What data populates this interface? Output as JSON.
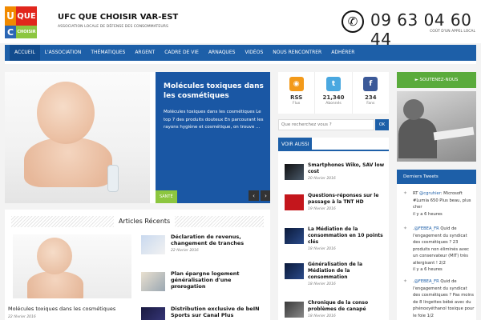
{
  "header": {
    "logo": {
      "u": "U",
      "que": "QUE",
      "c": "C",
      "choisir": "CHOISIR"
    },
    "title": "UFC QUE CHOISIR VAR-EST",
    "subtitle": "ASSOCIATION LOCALE DE DÉFENSE DES CONSOMMATEURS",
    "phone_icon": "phone-icon",
    "phone_number": "09 63 04 60 44",
    "phone_sub": "COÛT D'UN APPEL LOCAL"
  },
  "nav": [
    "ACCUEIL",
    "L'ASSOCIATION",
    "THÉMATIQUES",
    "ARGENT",
    "CADRE DE VIE",
    "ARNAQUES",
    "VIDÉOS",
    "NOUS RENCONTRER",
    "ADHÉRER"
  ],
  "slider": {
    "title": "Molécules toxiques dans les cosmétiques",
    "text": "Molécules toxiques dans les cosmétiques Le top 7 des produits douteux En parcourant les rayons hygiène et cosmétique, on trouve ...",
    "tag": "SANTÉ",
    "prev": "‹",
    "next": "›"
  },
  "articles": {
    "heading": "Articles Récents",
    "featured": {
      "title": "Molécules toxiques dans les cosmétiques",
      "date": "22 février 2016"
    },
    "items": [
      {
        "title": "Déclaration de revenus, changement de tranches",
        "date": "22 février 2016"
      },
      {
        "title": "Plan épargne logement généralisation d'une prorogation",
        "date": "21 février 2016"
      },
      {
        "title": "Distribution exclusive de beIN Sports sur Canal Plus",
        "date": ""
      }
    ]
  },
  "social": [
    {
      "icon": "rss-icon",
      "glyph": "◉",
      "count": "RSS",
      "label": "Flux"
    },
    {
      "icon": "twitter-icon",
      "glyph": "t",
      "count": "21,340",
      "label": "Abonnés"
    },
    {
      "icon": "facebook-icon",
      "glyph": "f",
      "count": "234",
      "label": "Fans"
    }
  ],
  "search": {
    "placeholder": "Que recherchez vous ?",
    "button": "OK"
  },
  "voir_aussi": {
    "heading": "VOIR AUSSI",
    "items": [
      {
        "title": "Smartphones Wiko, SAV low cost",
        "date": "20 février 2016"
      },
      {
        "title": "Questions-réponses sur le passage à la TNT HD",
        "date": "19 février 2016"
      },
      {
        "title": "La Médiation de la consommation en 10 points clés",
        "date": "18 février 2016"
      },
      {
        "title": "Généralisation de la Médiation de la consommation",
        "date": "18 février 2016"
      },
      {
        "title": "Chronique de la conso problèmes de canapé",
        "date": "18 février 2016"
      }
    ]
  },
  "sidebar": {
    "soutenez": "►  SOUTENEZ-NOUS",
    "tweets_heading": "Derniers Tweets",
    "tweets": [
      {
        "pre": "RT ",
        "handle": "@cgruhier",
        "text": ": Microsoft #Lumia 650 Plus beau, plus cher",
        "time": "il y a 6 heures"
      },
      {
        "pre": ".",
        "handle": "@FEBEA_FR",
        "text": " Quid de l'engagement du syndicat des cosmétiques ? 23 produits non éliminés avec un conservateur (MIT) très allergisant ! 2/2",
        "time": "il y a 6 heures"
      },
      {
        "pre": ".",
        "handle": "@FEBEA_FR",
        "text": " Quid de l'engagement du syndicat des cosmétiques ? Pas moins de 8 lingettes bébé avec du phénoxyéthanol toxique pour le foie 1/2",
        "time": ""
      }
    ]
  },
  "colors": {
    "primary": "#1d5fa8",
    "green": "#5aab3c",
    "tag": "#8cc63f"
  }
}
